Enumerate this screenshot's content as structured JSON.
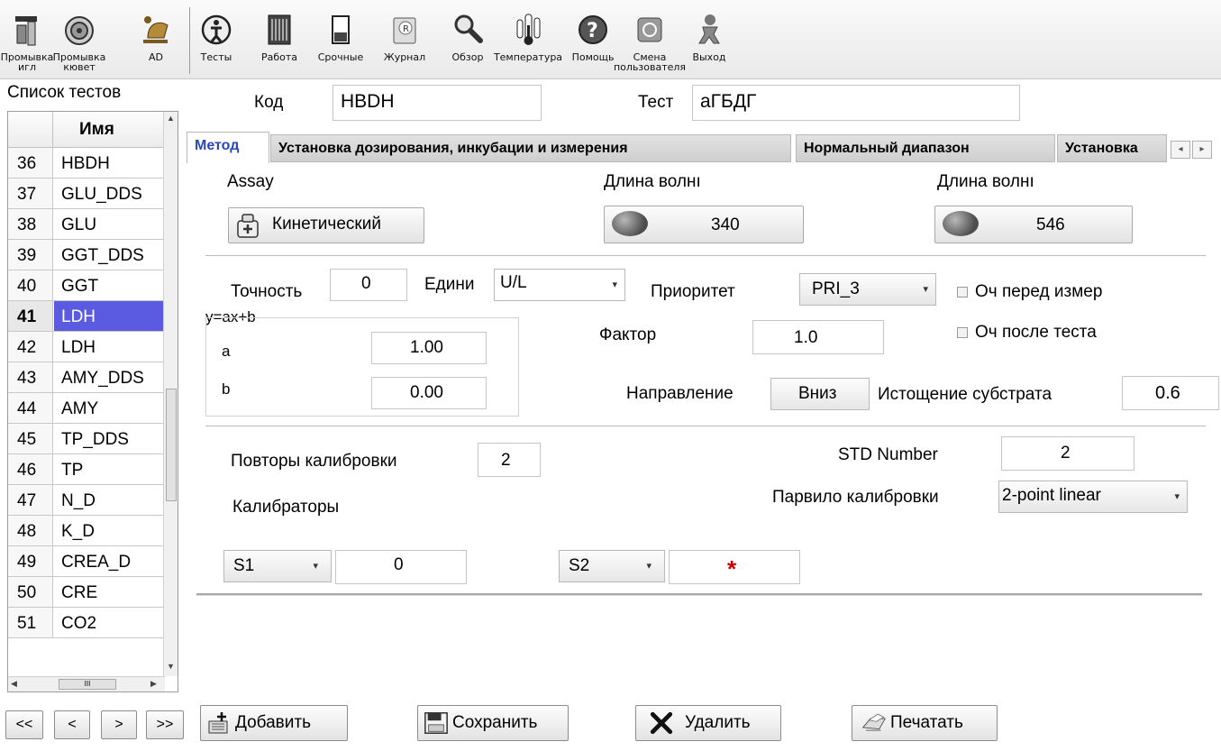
{
  "toolbar": {
    "items": [
      {
        "label_l1": "Промывка",
        "label_l2": "игл",
        "icon": "needle-wash-icon"
      },
      {
        "label_l1": "Промывка",
        "label_l2": "кювет",
        "icon": "cuvette-wash-icon"
      },
      {
        "label_l1": "AD",
        "label_l2": "",
        "icon": "ad-icon"
      },
      {
        "label_l1": "Тесты",
        "label_l2": "",
        "icon": "tests-icon"
      },
      {
        "label_l1": "Работа",
        "label_l2": "",
        "icon": "work-icon"
      },
      {
        "label_l1": "Срочные",
        "label_l2": "",
        "icon": "urgent-icon"
      },
      {
        "label_l1": "Журнал",
        "label_l2": "",
        "icon": "journal-icon"
      },
      {
        "label_l1": "Обзор",
        "label_l2": "",
        "icon": "magnifier-icon"
      },
      {
        "label_l1": "Температура",
        "label_l2": "",
        "icon": "thermometer-icon"
      },
      {
        "label_l1": "Помощь",
        "label_l2": "",
        "icon": "help-icon"
      },
      {
        "label_l1": "Смена",
        "label_l2": "пользователя",
        "icon": "switch-user-icon"
      },
      {
        "label_l1": "Выход",
        "label_l2": "",
        "icon": "exit-icon"
      }
    ]
  },
  "test_list": {
    "title": "Список тестов",
    "header_name": "Имя",
    "rows": [
      {
        "num": "36",
        "name": "HBDH"
      },
      {
        "num": "37",
        "name": "GLU_DDS"
      },
      {
        "num": "38",
        "name": "GLU"
      },
      {
        "num": "39",
        "name": "GGT_DDS"
      },
      {
        "num": "40",
        "name": "GGT"
      },
      {
        "num": "41",
        "name": "LDH"
      },
      {
        "num": "42",
        "name": "LDH"
      },
      {
        "num": "43",
        "name": "AMY_DDS"
      },
      {
        "num": "44",
        "name": "AMY"
      },
      {
        "num": "45",
        "name": "TP_DDS"
      },
      {
        "num": "46",
        "name": "TP"
      },
      {
        "num": "47",
        "name": "N_D"
      },
      {
        "num": "48",
        "name": "K_D"
      },
      {
        "num": "49",
        "name": "CREA_D"
      },
      {
        "num": "50",
        "name": "CRE"
      },
      {
        "num": "51",
        "name": "CO2"
      }
    ],
    "selected_num": "41",
    "hscroll_grip": "III"
  },
  "header": {
    "code_label": "Код",
    "code_value": "HBDH",
    "test_label": "Тест",
    "test_value": "аГБДГ"
  },
  "tabs": [
    {
      "label": "Метод",
      "active": true
    },
    {
      "label": "Установка дозирования, инкубации и измерения"
    },
    {
      "label": "Нормальный диапазон"
    },
    {
      "label": "Установка"
    }
  ],
  "method": {
    "assay_label": "Assay",
    "assay_button": "Кинетический",
    "wl1_label": "Длина волнı",
    "wl1_value": "340",
    "wl2_label": "Длина волнı",
    "wl2_value": "546",
    "precision_label": "Точность",
    "precision_value": "0",
    "units_label": "Едини",
    "units_value": "U/L",
    "priority_label": "Приоритет",
    "priority_value": "PRI_3",
    "clean_before_label": "Оч перед измер",
    "clean_after_label": "Оч после теста",
    "equation_label": "y=ax+b",
    "a_label": "a",
    "a_value": "1.00",
    "b_label": "b",
    "b_value": "0.00",
    "factor_label": "Фактор",
    "factor_value": "1.0",
    "direction_label": "Направление",
    "direction_value": "Вниз",
    "substrate_label": "Истощение субстрата",
    "substrate_value": "0.6"
  },
  "calibration": {
    "repeats_label": "Повторы калибровки",
    "repeats_value": "2",
    "std_label": "STD Number",
    "std_value": "2",
    "rule_label": "Парвило калибровки",
    "rule_value": "2-point linear",
    "calibrators_label": "Калибраторы",
    "s1_label": "S1",
    "s1_value": "0",
    "s2_label": "S2",
    "s2_value": "*",
    "s2_value_color": "#cc0000"
  },
  "bottom": {
    "nav_first": "<<",
    "nav_prev": "<",
    "nav_next": ">",
    "nav_last": ">>",
    "add": "Добавить",
    "save": "Сохранить",
    "delete": "Удалить",
    "print": "Печатать"
  },
  "colors": {
    "selection": "#5a5be0",
    "active_tab_text": "#2a47b8"
  }
}
